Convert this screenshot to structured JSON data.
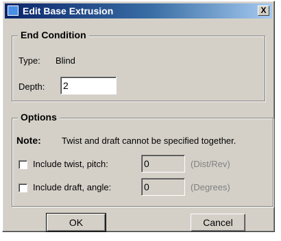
{
  "window": {
    "title": "Edit Base Extrusion",
    "close_label": "X"
  },
  "end_condition": {
    "legend": "End Condition",
    "type_label": "Type:",
    "type_value": "Blind",
    "depth_label": "Depth:",
    "depth_value": "2"
  },
  "options": {
    "legend": "Options",
    "note_label": "Note:",
    "note_text": "Twist and draft cannot be specified together.",
    "twist": {
      "label": "Include twist, pitch:",
      "value": "0",
      "unit": "(Dist/Rev)",
      "checked": false
    },
    "draft": {
      "label": "Include draft, angle:",
      "value": "0",
      "unit": "(Degrees)",
      "checked": false
    }
  },
  "buttons": {
    "ok": "OK",
    "cancel": "Cancel"
  },
  "colors": {
    "title_bar_start": "#0a246a",
    "dialog_face": "#d4d0c8"
  }
}
